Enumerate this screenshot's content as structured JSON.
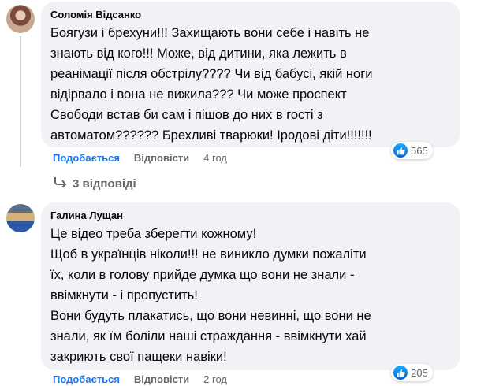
{
  "comments": [
    {
      "author": "Соломія Відсанко",
      "lines": [
        "Боягузи і брехуни!!! Захищають вони себе і навіть не",
        "знають від кого!!! Може, від дитини, яка лежить в",
        "реанімації після обстрілу???? Чи від бабусі, якій ноги",
        "відірвало і вона не вижила??? Чи може проспект",
        "Свободи встав би сам і пішов до них в гості з",
        "автоматом?????? Брехливі тварюки! Іродові діти!!!!!!!"
      ],
      "reaction_count": "565",
      "like_label": "Подобається",
      "reply_label": "Відповісти",
      "time": "4 год"
    },
    {
      "author": "Галина Лущан",
      "lines": [
        "Це відео треба зберегти кожному!",
        "Щоб в українців ніколи!!! не виникло думки пожаліти",
        "їх, коли в голову прийде думка що вони не знали -",
        "ввімкнути - і пропустить!",
        "Вони будуть плакатись, що вони невинні, що вони не",
        "знали, як їм боліли наші страждання - ввімкнути хай",
        "закриють свої пащеки навіки!"
      ],
      "reaction_count": "205",
      "like_label": "Подобається",
      "reply_label": "Відповісти",
      "time": "2 год"
    }
  ],
  "replies_link": "3 відповіді",
  "icons": {
    "like": "thumbs-up-icon",
    "reply_arrow": "reply-arrow-icon"
  },
  "colors": {
    "like_blue": "#1877f2",
    "bubble": "#f0f2f5",
    "meta": "#65676b"
  }
}
